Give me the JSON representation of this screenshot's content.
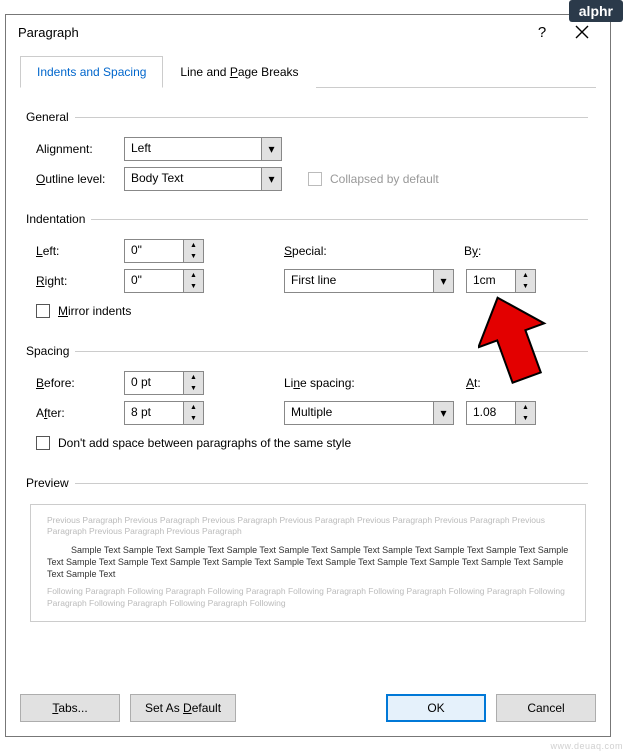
{
  "logo": "alphr",
  "watermark": "www.deuaq.com",
  "dialog": {
    "title": "Paragraph",
    "help_tip": "?",
    "tabs": {
      "indents": "Indents and Spacing",
      "breaks_pre": "Line and ",
      "breaks_ul": "P",
      "breaks_post": "age Breaks"
    },
    "general": {
      "legend": "General",
      "alignment_label": "Alignment:",
      "alignment_value": "Left",
      "outline_pre": "O",
      "outline_mid": "utline level:",
      "outline_value": "Body Text",
      "collapsed_label": "Collapsed by default"
    },
    "indentation": {
      "legend": "Indentation",
      "left_ul": "L",
      "left_post": "eft:",
      "left_value": "0\"",
      "right_ul": "R",
      "right_post": "ight:",
      "right_value": "0\"",
      "special_ul": "S",
      "special_post": "pecial:",
      "special_value": "First line",
      "by_ul": "y",
      "by_pre": "B",
      "by_post": ":",
      "by_value": "1cm",
      "mirror_ul": "M",
      "mirror_post": "irror indents"
    },
    "spacing": {
      "legend": "Spacing",
      "before_ul": "B",
      "before_post": "efore:",
      "before_value": "0 pt",
      "after_ul": "f",
      "after_pre": "A",
      "after_post": "ter:",
      "after_value": "8 pt",
      "line_ul": "n",
      "line_pre": "Li",
      "line_post": "e spacing:",
      "line_value": "Multiple",
      "at_ul": "A",
      "at_post": "t:",
      "at_value": "1.08",
      "dont_add": "Don't add space between paragraphs of the same style"
    },
    "preview": {
      "legend": "Preview",
      "prev_para": "Previous Paragraph Previous Paragraph Previous Paragraph Previous Paragraph Previous Paragraph Previous Paragraph Previous Paragraph Previous Paragraph Previous Paragraph",
      "sample": "Sample Text Sample Text Sample Text Sample Text Sample Text Sample Text Sample Text Sample Text Sample Text Sample Text Sample Text Sample Text Sample Text Sample Text Sample Text Sample Text Sample Text Sample Text Sample Text Sample Text Sample Text",
      "next_para": "Following Paragraph Following Paragraph Following Paragraph Following Paragraph Following Paragraph Following Paragraph Following Paragraph Following Paragraph Following Paragraph Following"
    },
    "buttons": {
      "tabs_ul": "T",
      "tabs_post": "abs...",
      "default_pre": "Set As ",
      "default_ul": "D",
      "default_post": "efault",
      "ok": "OK",
      "cancel": "Cancel"
    }
  }
}
